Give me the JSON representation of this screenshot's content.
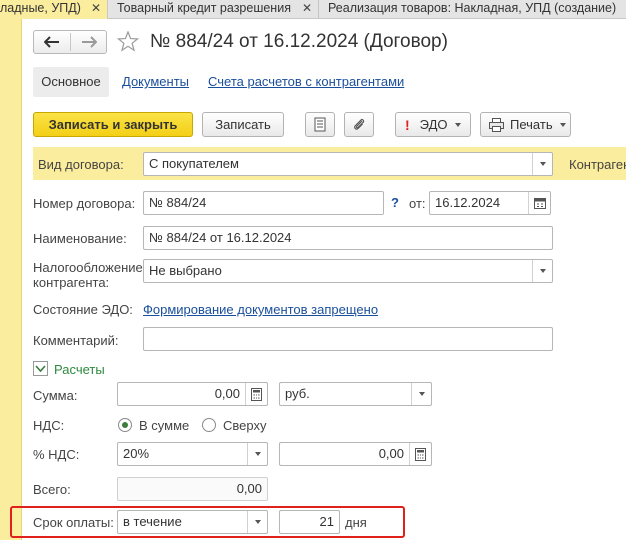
{
  "tabs": [
    {
      "label": "ладные, УПД)",
      "active": true
    },
    {
      "label": "Товарный кредит разрешения",
      "active": false
    },
    {
      "label": "Реализация товаров: Накладная, УПД (создание)",
      "active": false
    }
  ],
  "document": {
    "title": "№ 884/24 от 16.12.2024 (Договор)"
  },
  "section_tabs": {
    "main": "Основное",
    "documents": "Документы",
    "accounts": "Счета расчетов с контрагентами"
  },
  "toolbar": {
    "save_close": "Записать и закрыть",
    "save": "Записать",
    "edo": "ЭДО",
    "print": "Печать"
  },
  "form": {
    "contract_type_label": "Вид договора:",
    "contract_type_value": "С покупателем",
    "counterparty_label": "Контрагент",
    "number_label": "Номер договора:",
    "number_value": "№ 884/24",
    "help_mark": "?",
    "date_label": "от:",
    "date_value": "16.12.2024",
    "name_label": "Наименование:",
    "name_value": "№ 884/24 от 16.12.2024",
    "tax_label_line1": "Налогообложение",
    "tax_label_line2": "контрагента:",
    "tax_value": "Не выбрано",
    "edo_state_label": "Состояние ЭДО:",
    "edo_state_value": "Формирование документов запрещено",
    "comment_label": "Комментарий:",
    "comment_value": ""
  },
  "settlements": {
    "section_label": "Расчеты",
    "sum_label": "Сумма:",
    "sum_value": "0,00",
    "currency_value": "руб.",
    "vat_label": "НДС:",
    "vat_in_sum": "В сумме",
    "vat_on_top": "Сверху",
    "vat_mode": "in_sum",
    "vat_rate_label": "% НДС:",
    "vat_rate_value": "20%",
    "vat_amount_value": "0,00",
    "total_label": "Всего:",
    "total_value": "0,00",
    "term_label": "Срок оплаты:",
    "term_mode_value": "в течение",
    "term_days_value": "21",
    "term_unit": "дня"
  },
  "colors": {
    "accent_yellow": "#fbed9e",
    "primary_button": "#f5d22a",
    "link": "#1a4f9c",
    "highlight_box": "#e0201c"
  }
}
